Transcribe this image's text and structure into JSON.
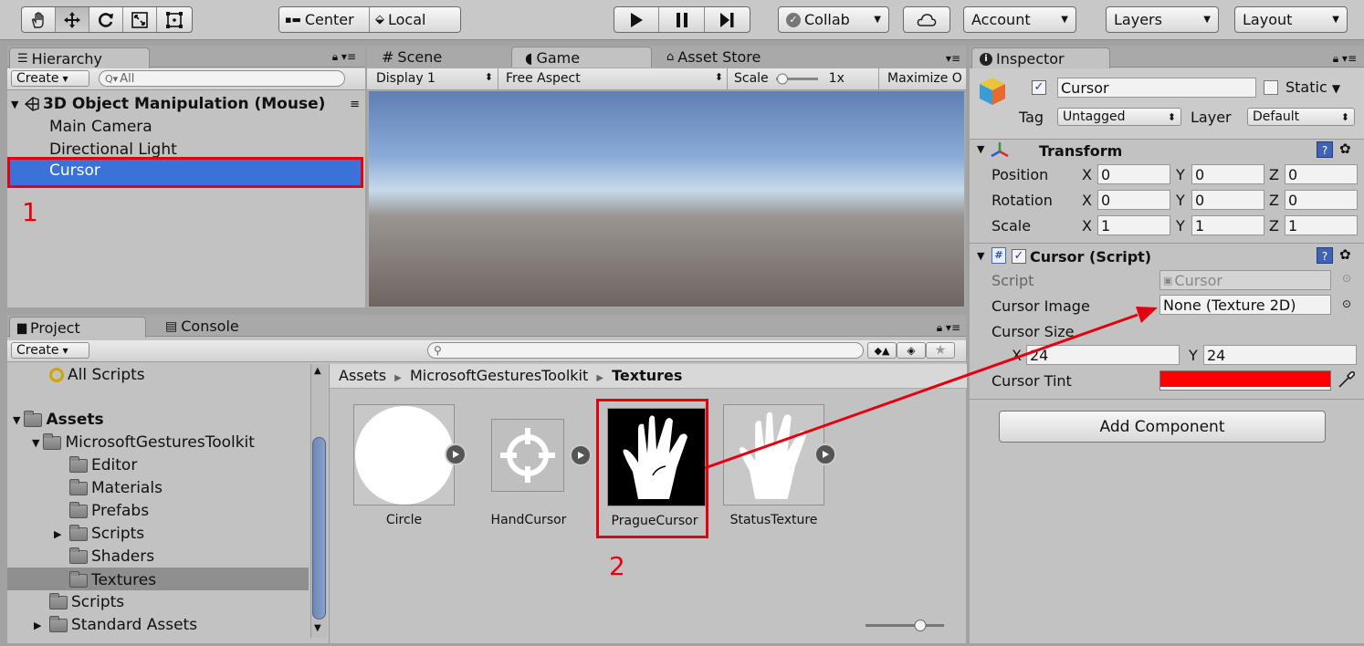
{
  "toolbar": {
    "transform_tools": [
      "hand-icon",
      "move-icon",
      "rotate-icon",
      "scale-icon",
      "rect-tool-icon"
    ],
    "pivot": "Center",
    "space": "Local",
    "collab": "Collab",
    "account": "Account",
    "layers": "Layers",
    "layout": "Layout"
  },
  "hierarchy": {
    "tab": "Hierarchy",
    "create": "Create",
    "search_placeholder": "All",
    "scene": "3D Object Manipulation (Mouse)",
    "items": [
      "Main Camera",
      "Directional Light",
      "Cursor"
    ],
    "selected": "Cursor"
  },
  "view_tabs": {
    "scene": "Scene",
    "game": "Game",
    "asset_store": "Asset Store"
  },
  "game": {
    "display": "Display 1",
    "aspect": "Free Aspect",
    "scale_label": "Scale",
    "scale_value": "1x",
    "maximize": "Maximize O"
  },
  "project": {
    "tab": "Project",
    "console_tab": "Console",
    "create": "Create",
    "favorites": [
      "All Scripts"
    ],
    "tree": {
      "root": "Assets",
      "toolkit": "MicrosoftGesturesToolkit",
      "children": [
        "Editor",
        "Materials",
        "Prefabs",
        "Scripts",
        "Shaders",
        "Textures"
      ],
      "scripts": "Scripts",
      "standard": "Standard Assets"
    },
    "breadcrumb": [
      "Assets",
      "MicrosoftGesturesToolkit",
      "Textures"
    ],
    "assets": [
      "Circle",
      "HandCursor",
      "PragueCursor",
      "StatusTexture"
    ]
  },
  "inspector": {
    "tab": "Inspector",
    "object_name": "Cursor",
    "static_label": "Static",
    "tag_label": "Tag",
    "tag_value": "Untagged",
    "layer_label": "Layer",
    "layer_value": "Default",
    "transform": {
      "title": "Transform",
      "position_label": "Position",
      "rotation_label": "Rotation",
      "scale_label": "Scale",
      "position": {
        "x": "0",
        "y": "0",
        "z": "0"
      },
      "rotation": {
        "x": "0",
        "y": "0",
        "z": "0"
      },
      "scale": {
        "x": "1",
        "y": "1",
        "z": "1"
      }
    },
    "script_component": {
      "title": "Cursor (Script)",
      "script_label": "Script",
      "script_value": "Cursor",
      "image_label": "Cursor Image",
      "image_value": "None (Texture 2D)",
      "size_label": "Cursor Size",
      "size_x": "24",
      "size_y": "24",
      "tint_label": "Cursor Tint",
      "tint_color": "#ff0000"
    },
    "add_component": "Add Component"
  },
  "annotations": {
    "step1": "1",
    "step2": "2",
    "highlight_color": "#e3000f"
  }
}
